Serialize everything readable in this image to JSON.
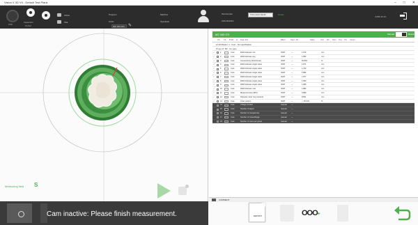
{
  "window": {
    "title": "Vision X 3D V4 - Default Test Plans",
    "controls": [
      "–",
      "□",
      "✕"
    ]
  },
  "toolbar": {
    "gauge_label": "0.00",
    "btn1_label": "Inspection",
    "btn1_sub": "Center",
    "btn2_text_a": "Active",
    "btn2_text_b": "Stat",
    "program_label": "Program",
    "order_label": "Order",
    "order_value": "000 000 000",
    "machine_label": "Machine",
    "operation_label": "Operation",
    "user_label_a": "Serviceman",
    "user_label_b": "Administrator",
    "dropdown_value": "Tisk pusat vlastní maska",
    "status_text": "Ready",
    "right_text": "JOBS 30.15"
  },
  "viewport": {
    "measuring_label": "Measuring field",
    "measuring_value": "S"
  },
  "status": {
    "message": "Cam inactive: Please finish measurement."
  },
  "panel": {
    "header": "M2 440 CS",
    "toggle_left": "Manual",
    "toggle_right": "Result",
    "columns": [
      "Ch.",
      "Ch",
      "Profil",
      "H",
      "Feat. Ref.",
      "Effect",
      "Spec. 1%",
      "Value",
      "Unit",
      "RC",
      "Nom",
      "Tol+",
      "Tol-",
      "Comm."
    ],
    "group1": "▸ Full Measur. 1 - Cust. - No specification",
    "group2": "▾ Log. Hi. SR - mx_type",
    "rows": [
      {
        "ch": "1",
        "prof": "Cust.",
        "name": "Wall thickness min",
        "eff": "ISOP",
        "spec": "—",
        "val": "1.072",
        "unit": "mm"
      },
      {
        "ch": "2",
        "prof": "Cust.",
        "name": "Wall thickness avg.",
        "eff": "ISOP",
        "spec": "—",
        "val": "1.582",
        "unit": "mm"
      },
      {
        "ch": "3",
        "prof": "Cust.",
        "name": "Concentricity (dmin/dmax)",
        "eff": "ISOP",
        "spec": "—",
        "val": "66.894",
        "unit": "%"
      },
      {
        "ch": "4",
        "prof": "Cust.",
        "name": "Wall thickness single value",
        "eff": "ISOP",
        "spec": "—",
        "val": "1.871",
        "unit": "mm"
      },
      {
        "ch": "5",
        "prof": "Cust.",
        "name": "Wall thickness single value",
        "eff": "ISOP",
        "spec": "—",
        "val": "1.793",
        "unit": "mm"
      },
      {
        "ch": "6",
        "prof": "Cust.",
        "name": "Wall thickness single value",
        "eff": "ISOP",
        "spec": "—",
        "val": "1.882",
        "unit": "mm"
      },
      {
        "ch": "7",
        "prof": "Cust.",
        "name": "Wall thickness single value",
        "eff": "ISOP",
        "spec": "—",
        "val": "1.877",
        "unit": "mm"
      },
      {
        "ch": "8",
        "prof": "Cust.",
        "name": "Wall thickness single value",
        "eff": "ISOP",
        "spec": "—",
        "val": "1.583",
        "unit": "mm"
      },
      {
        "ch": "9",
        "prof": "Cust.",
        "name": "Wall thickness single value",
        "eff": "ISOP",
        "spec": "—",
        "val": "1.380",
        "unit": "mm"
      },
      {
        "ch": "10",
        "prof": "Cust.",
        "name": "Wall thickness max",
        "eff": "ISOP",
        "spec": "—",
        "val": "1.882",
        "unit": "mm"
      },
      {
        "ch": "11",
        "prof": "Cust.",
        "name": "Measured area (dPix)",
        "eff": "ISOP",
        "spec": "—",
        "val": "0.880",
        "unit": "mm"
      },
      {
        "ch": "12",
        "prof": "Cust.",
        "name": "Diameter outer ring (contour)",
        "eff": "ISOP",
        "spec": "—",
        "val": "8.501",
        "unit": "mm"
      },
      {
        "ch": "13",
        "prof": "Cust.",
        "name": "Outer pattern",
        "eff": "ISOP",
        "spec": "—",
        "val": "✓  30.034",
        "unit": "%"
      }
    ],
    "dark_rows": [
      {
        "ch": "14",
        "prof": "Cust.",
        "name": "Charge number",
        "eff": "manual",
        "spec": "—"
      },
      {
        "ch": "15",
        "prof": "Cust.",
        "name": "Number of layers",
        "eff": "manual",
        "spec": "—"
      },
      {
        "ch": "16",
        "prof": "Cust.",
        "name": "Number of compartmen.",
        "eff": "manual",
        "spec": "—"
      },
      {
        "ch": "17",
        "prof": "Cust.",
        "name": "Number of Cores/Single",
        "eff": "manual",
        "spec": "—"
      },
      {
        "ch": "18",
        "prof": "Cust.",
        "name": "Number of cores per group",
        "eff": "manual",
        "spec": "—"
      }
    ],
    "comment_label": "COMMENT"
  },
  "actions": {
    "report_label": "REPORT",
    "ooo_label": "OOO",
    "ooo_plus": "+"
  },
  "colors": {
    "accent": "#4caf50",
    "dark": "#2c2c2c"
  }
}
